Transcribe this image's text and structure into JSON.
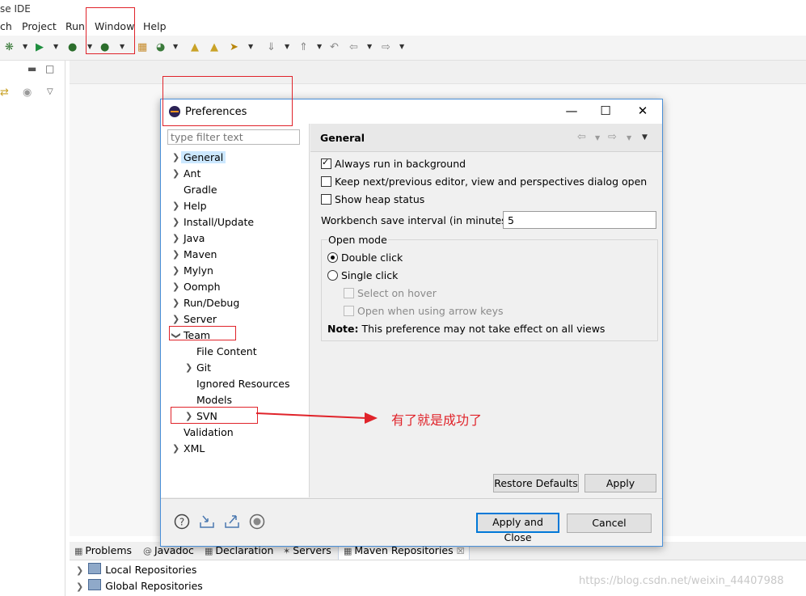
{
  "ide": {
    "title_fragment": "se IDE",
    "menu": [
      "ch",
      "Project",
      "Run",
      "Window",
      "Help"
    ]
  },
  "bottom_panel": {
    "tabs": [
      "Problems",
      "Javadoc",
      "Declaration",
      "Servers",
      "Maven Repositories"
    ],
    "tab_close": "☒",
    "repositories": [
      "Local Repositories",
      "Global Repositories"
    ]
  },
  "watermark": "https://blog.csdn.net/weixin_44407988",
  "annotation": "有了就是成功了",
  "dialog": {
    "title": "Preferences",
    "filter_placeholder": "type filter text",
    "tree": [
      {
        "label": "General",
        "expandable": true,
        "selected": true
      },
      {
        "label": "Ant",
        "expandable": true
      },
      {
        "label": "Gradle",
        "expandable": false
      },
      {
        "label": "Help",
        "expandable": true
      },
      {
        "label": "Install/Update",
        "expandable": true
      },
      {
        "label": "Java",
        "expandable": true
      },
      {
        "label": "Maven",
        "expandable": true
      },
      {
        "label": "Mylyn",
        "expandable": true
      },
      {
        "label": "Oomph",
        "expandable": true
      },
      {
        "label": "Run/Debug",
        "expandable": true
      },
      {
        "label": "Server",
        "expandable": true
      },
      {
        "label": "Team",
        "expanded": true
      },
      {
        "label": "File Content",
        "child": true
      },
      {
        "label": "Git",
        "child": true,
        "expandable": true
      },
      {
        "label": "Ignored Resources",
        "child": true
      },
      {
        "label": "Models",
        "child": true
      },
      {
        "label": "SVN",
        "child": true,
        "expandable": true
      },
      {
        "label": "Validation",
        "expandable": false
      },
      {
        "label": "XML",
        "expandable": true
      }
    ],
    "page": {
      "heading": "General",
      "always_run_bg": "Always run in background",
      "keep_next_prev": "Keep next/previous editor, view and perspectives dialog open",
      "show_heap": "Show heap status",
      "interval_label": "Workbench save interval (in minutes):",
      "interval_value": "5",
      "open_mode_label": "Open mode",
      "double_click": "Double click",
      "single_click": "Single click",
      "select_on_hover": "Select on hover",
      "open_arrow_keys": "Open when using arrow keys",
      "note_bold": "Note:",
      "note_text": " This preference may not take effect on all views"
    },
    "buttons": {
      "restore_defaults": "Restore Defaults",
      "apply": "Apply",
      "apply_and_close": "Apply and Close",
      "cancel": "Cancel"
    }
  },
  "colors": {
    "highlight_red": "#e0232a",
    "selection": "#cce8ff",
    "focus_blue": "#0078d7"
  }
}
